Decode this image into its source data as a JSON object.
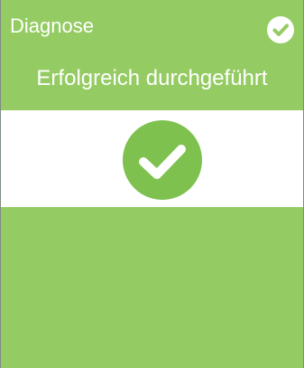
{
  "tile": {
    "title": "Diagnose",
    "status": "Erfolgreich durchgeführt",
    "header_icon": "check-circle-icon",
    "main_icon": "check-circle-icon"
  },
  "colors": {
    "accent_green": "#95cb63",
    "icon_white": "#ffffff",
    "border": "#7f8a85"
  }
}
